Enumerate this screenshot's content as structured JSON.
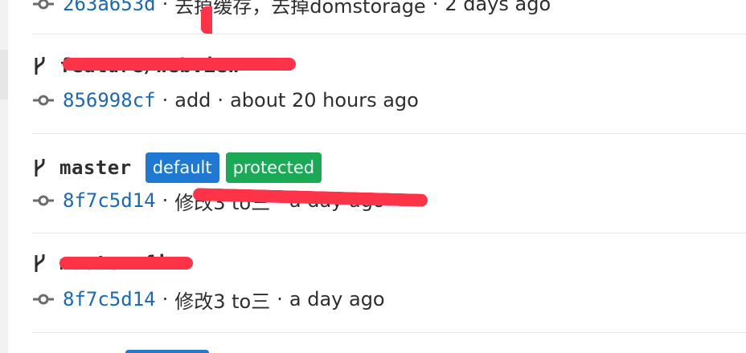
{
  "colors": {
    "sha_link": "#1b69b6",
    "default_badge": "#1f78d1",
    "protected_badge": "#1aaa55",
    "redaction": "#ff3347"
  },
  "icons": {
    "branch": "branch-icon",
    "commit": "commit-icon"
  },
  "rows": [
    {
      "commit_sha": "263a653d",
      "commit_message": "去掉缓存，去掉domstorage",
      "commit_time": "2 days ago"
    },
    {
      "branch_name": "feature/webview",
      "branch_redacted": true,
      "commit_sha": "856998cf",
      "commit_message": "add",
      "commit_time": "about 20 hours ago"
    },
    {
      "branch_name": "master",
      "badges": [
        "default",
        "protected"
      ],
      "commit_sha": "8f7c5d14",
      "commit_message": "修改3 to三",
      "commit_time": "a day ago",
      "commit_redacted": true
    },
    {
      "branch_name": "master-fix",
      "branch_redacted": true,
      "commit_sha": "8f7c5d14",
      "commit_message": "修改3 to三",
      "commit_time": "a day ago"
    }
  ],
  "separator": "·"
}
